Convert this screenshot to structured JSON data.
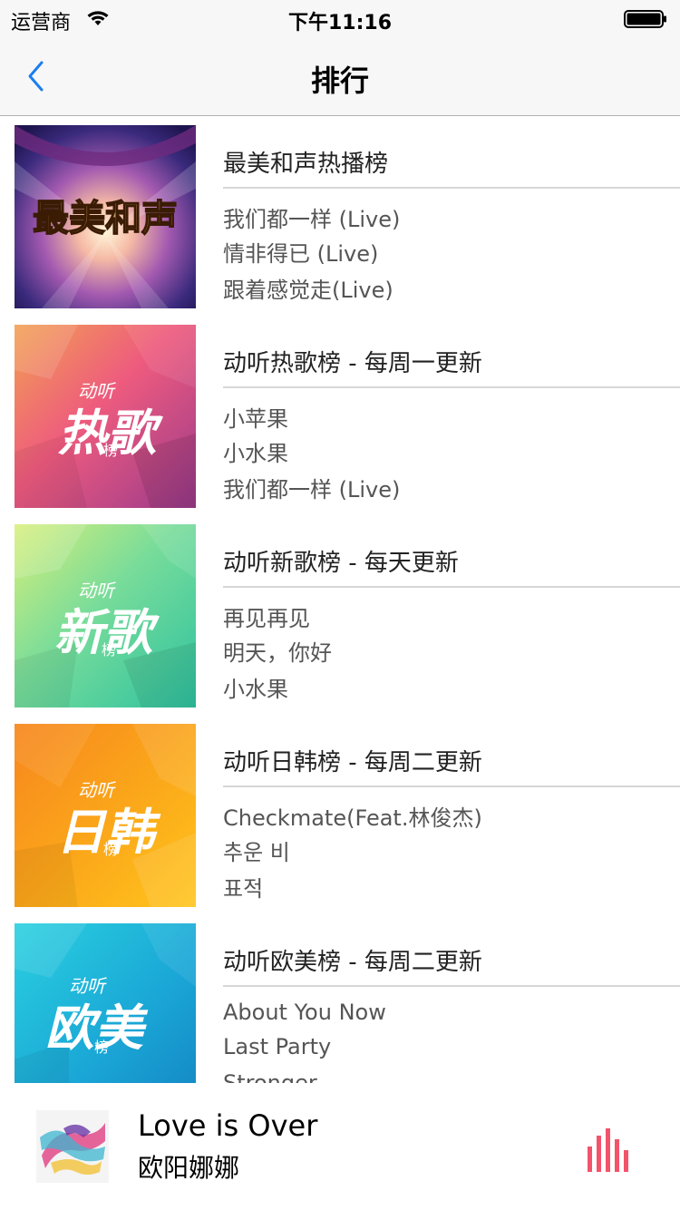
{
  "status_bar": {
    "carrier": "运营商",
    "time": "下午11:16"
  },
  "nav": {
    "title": "排行",
    "back_icon": "chevron-left-icon"
  },
  "rankings": [
    {
      "title": "最美和声热播榜",
      "cover": {
        "text": "最美和声",
        "icon": "show-logo"
      },
      "songs": [
        "我们都一样 (Live)",
        "情非得已 (Live)",
        "跟着感觉走(Live)"
      ]
    },
    {
      "title": "动听热歌榜 - 每周一更新",
      "cover": {
        "top": "动听",
        "main": "热歌",
        "sub": "榜"
      },
      "songs": [
        "小苹果",
        "小水果",
        "我们都一样 (Live)"
      ]
    },
    {
      "title": "动听新歌榜 - 每天更新",
      "cover": {
        "top": "动听",
        "main": "新歌",
        "sub": "榜"
      },
      "songs": [
        "再见再见",
        "明天，你好",
        "小水果"
      ]
    },
    {
      "title": "动听日韩榜 - 每周二更新",
      "cover": {
        "top": "动听",
        "main": "日韩",
        "sub": "榜"
      },
      "songs": [
        "Checkmate(Feat.林俊杰)",
        "추운 비",
        "표적"
      ]
    },
    {
      "title": "动听欧美榜 - 每周二更新",
      "cover": {
        "top": "动听",
        "main": "欧美",
        "sub": "榜"
      },
      "songs": [
        "About You Now",
        "Last Party",
        "Stronger"
      ]
    }
  ],
  "player": {
    "song": "Love is Over",
    "artist": "欧阳娜娜",
    "equalizer_icon": "equalizer-icon"
  },
  "colors": {
    "accent": "#1a7ef0",
    "equalizer": "#f2546b"
  }
}
